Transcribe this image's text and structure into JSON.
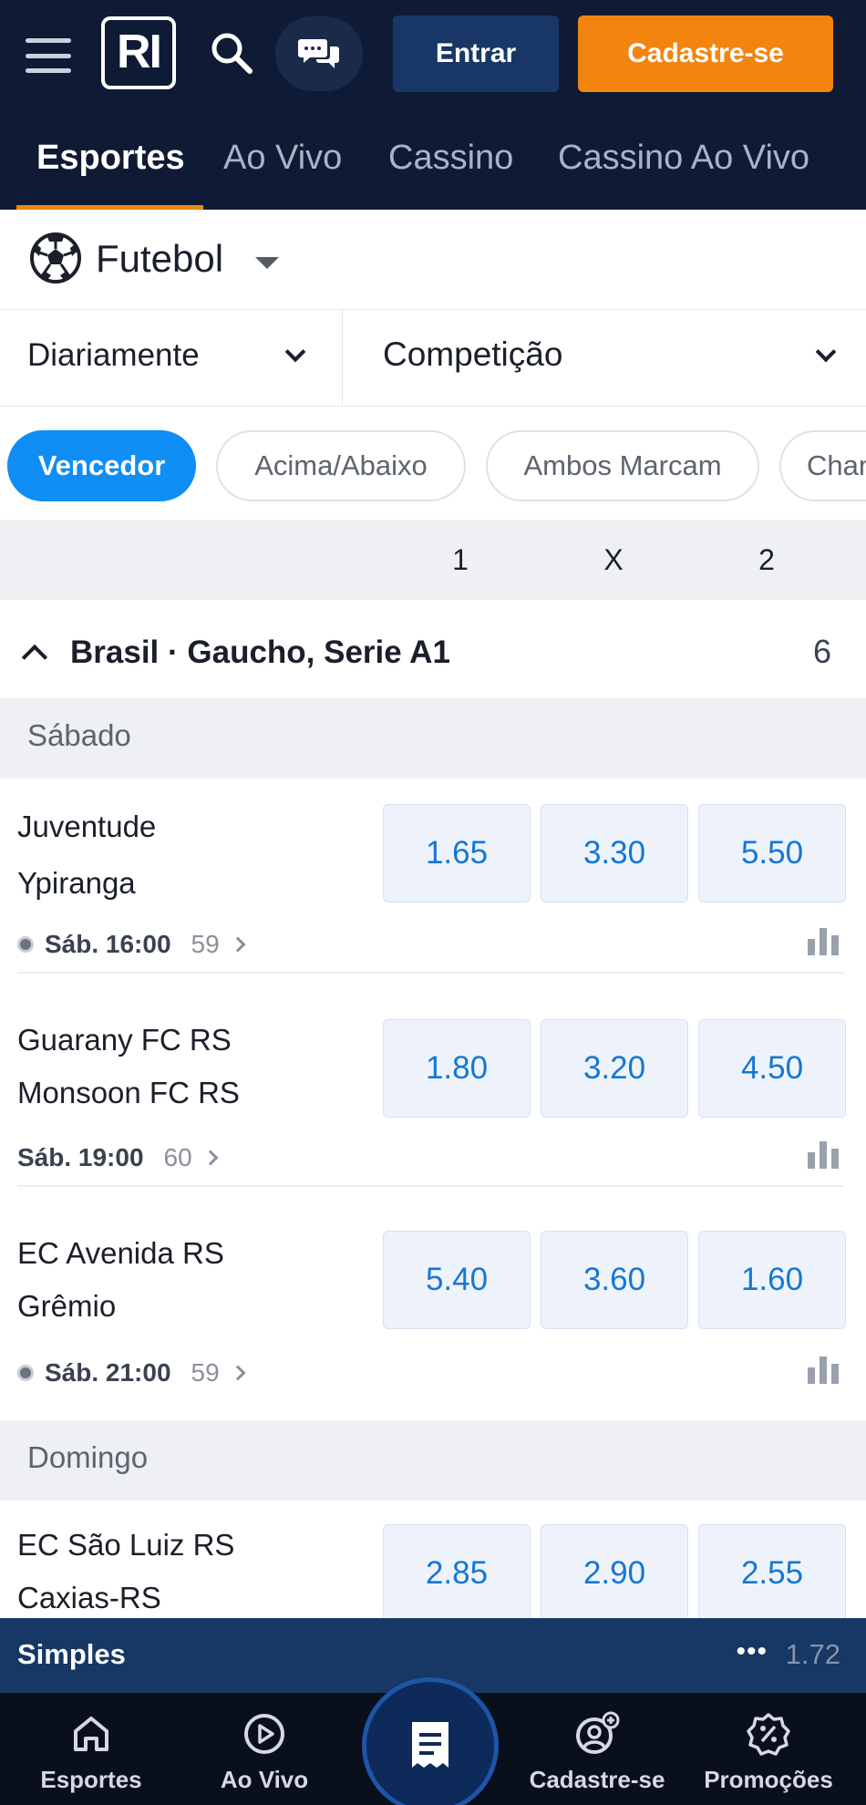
{
  "header": {
    "logo_text": "RI",
    "login_label": "Entrar",
    "signup_label": "Cadastre-se",
    "colors": {
      "background": "#0f1b35",
      "signup": "#f1850f",
      "login": "#183766",
      "accent": "#0f8ef5"
    }
  },
  "nav": {
    "tabs": [
      {
        "label": "Esportes",
        "active": true
      },
      {
        "label": "Ao Vivo"
      },
      {
        "label": "Cassino"
      },
      {
        "label": "Cassino Ao Vivo"
      }
    ]
  },
  "sport": {
    "label": "Futebol",
    "icon": "soccer-ball-icon"
  },
  "filters": {
    "period": "Diariamente",
    "competition": "Competição"
  },
  "markets": [
    {
      "label": "Vencedor",
      "active": true
    },
    {
      "label": "Acima/Abaixo"
    },
    {
      "label": "Ambos Marcam"
    },
    {
      "label": "Chan"
    }
  ],
  "odds_header": [
    "1",
    "X",
    "2"
  ],
  "league": {
    "name": "Brasil · Gaucho, Serie A1",
    "count": "6"
  },
  "days": [
    "Sábado",
    "Domingo"
  ],
  "matches": [
    {
      "home": "Juventude",
      "away": "Ypiranga",
      "odds": [
        "1.65",
        "3.30",
        "5.50"
      ],
      "time": "Sáb. 16:00",
      "markets": "59",
      "live_dot": true
    },
    {
      "home": "Guarany FC RS",
      "away": "Monsoon FC RS",
      "odds": [
        "1.80",
        "3.20",
        "4.50"
      ],
      "time": "Sáb. 19:00",
      "markets": "60",
      "live_dot": false
    },
    {
      "home": "EC Avenida RS",
      "away": "Grêmio",
      "odds": [
        "5.40",
        "3.60",
        "1.60"
      ],
      "time": "Sáb. 21:00",
      "markets": "59",
      "live_dot": true
    },
    {
      "home": "EC São Luiz RS",
      "away": "Caxias-RS",
      "odds": [
        "2.85",
        "2.90",
        "2.55"
      ]
    }
  ],
  "betslip": {
    "label": "Simples",
    "dots": "•••",
    "odds": "1.72"
  },
  "bottom_nav": [
    {
      "label": "Esportes",
      "icon": "home-icon"
    },
    {
      "label": "Ao Vivo",
      "icon": "play-icon"
    },
    {
      "label": "",
      "icon": "betslip-icon"
    },
    {
      "label": "Cadastre-se",
      "icon": "user-add-icon"
    },
    {
      "label": "Promoções",
      "icon": "promo-badge-icon"
    }
  ]
}
